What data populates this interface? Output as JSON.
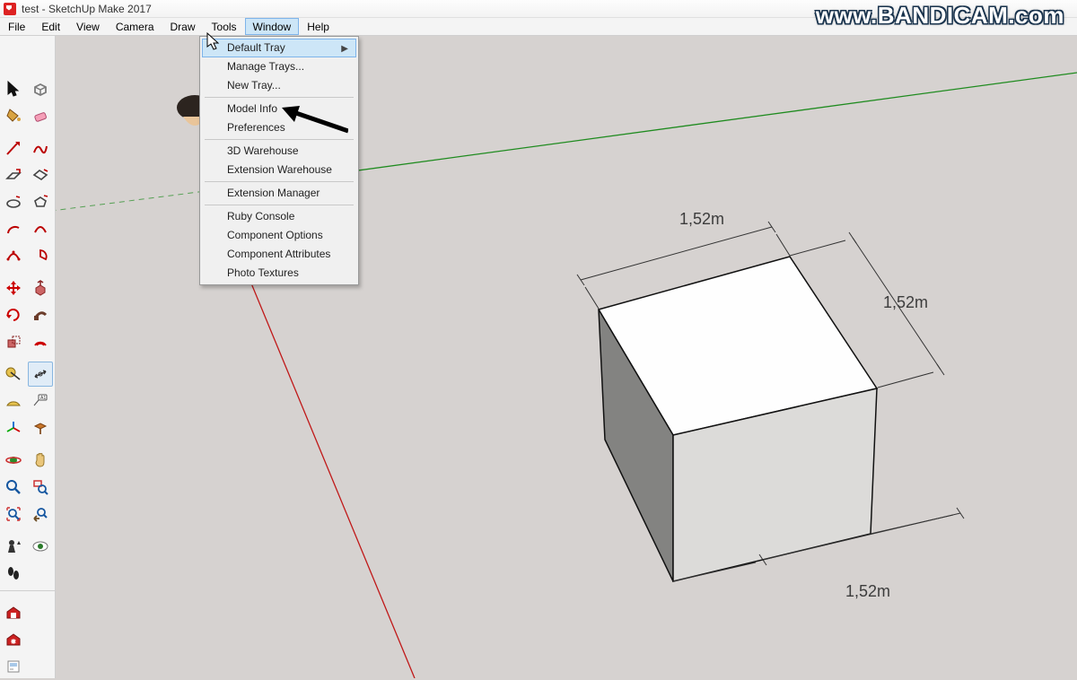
{
  "title": "test - SketchUp Make 2017",
  "watermark": "www.BANDICAM.com",
  "menus": {
    "file": "File",
    "edit": "Edit",
    "view": "View",
    "camera": "Camera",
    "draw": "Draw",
    "tools": "Tools",
    "window": "Window",
    "help": "Help"
  },
  "window_menu": {
    "default_tray": "Default Tray",
    "manage_trays": "Manage Trays...",
    "new_tray": "New Tray...",
    "model_info": "Model Info",
    "preferences": "Preferences",
    "warehouse3d": "3D Warehouse",
    "ext_warehouse": "Extension Warehouse",
    "ext_manager": "Extension Manager",
    "ruby_console": "Ruby Console",
    "comp_options": "Component Options",
    "comp_attrs": "Component Attributes",
    "photo_textures": "Photo Textures"
  },
  "dimensions": {
    "top": "1,52m",
    "right": "1,52m",
    "bottom": "1,52m"
  },
  "tool_names": {
    "select": "select",
    "paint": "paint-bucket",
    "eraser": "eraser",
    "line": "line",
    "freehand": "freehand",
    "rect": "rectangle",
    "rotrect": "rotated-rect",
    "circle": "circle",
    "polygon": "polygon",
    "arc": "arc",
    "arc2": "arc2",
    "arc3": "arc3",
    "pie": "pie",
    "move": "move",
    "pushpull": "push-pull",
    "rotate": "rotate",
    "followme": "follow-me",
    "scale": "scale",
    "offset": "offset",
    "tape": "tape-measure",
    "dimension": "dimension",
    "protractor": "protractor",
    "text": "text",
    "axes": "axes",
    "section": "section",
    "orbit": "orbit",
    "pan": "pan",
    "zoom": "zoom",
    "zoomwin": "zoom-window",
    "zoomext": "zoom-extents",
    "prev": "previous-view",
    "position": "position-camera",
    "look": "look-around",
    "walk": "walk",
    "wh3d": "3d-warehouse",
    "exwh": "extension-warehouse",
    "layouts": "layout"
  }
}
